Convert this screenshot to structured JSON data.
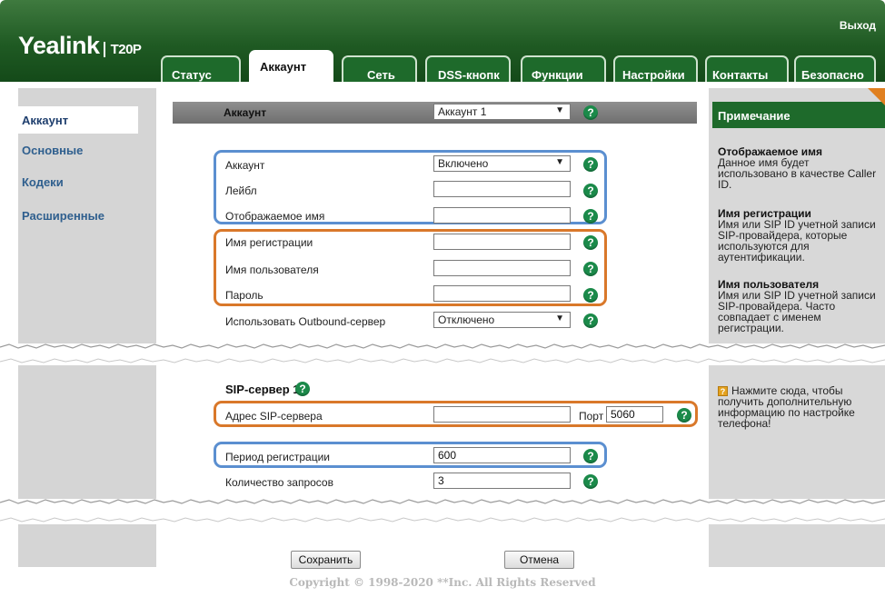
{
  "header": {
    "brand": "Yealink",
    "model": "T20P",
    "exit_label": "Выход",
    "tabs": [
      "Статус",
      "Аккаунт",
      "Сеть",
      "DSS-кнопк",
      "Функции",
      "Настройки",
      "Контакты",
      "Безопасно"
    ]
  },
  "sidebar": {
    "items": [
      "Аккаунт",
      "Основные",
      "Кодеки",
      "Расширенные"
    ]
  },
  "main": {
    "title": "Аккаунт",
    "account_select": "Аккаунт 1",
    "fields": {
      "account": {
        "label": "Аккаунт",
        "value": "Включено"
      },
      "label": {
        "label": "Лейбл",
        "value": ""
      },
      "display_name": {
        "label": "Отображаемое имя",
        "value": ""
      },
      "register_name": {
        "label": "Имя регистрации",
        "value": ""
      },
      "user_name": {
        "label": "Имя пользователя",
        "value": ""
      },
      "password": {
        "label": "Пароль",
        "value": ""
      },
      "outbound": {
        "label": "Использовать Outbound-сервер",
        "value": "Отключено"
      }
    },
    "sip_server": {
      "title": "SIP-сервер 1",
      "address_label": "Адрес SIP-сервера",
      "address_value": "",
      "port_label": "Порт",
      "port_value": "5060",
      "period_label": "Период регистрации",
      "period_value": "600",
      "retries_label": "Количество запросов",
      "retries_value": "3"
    },
    "buttons": {
      "save": "Сохранить",
      "cancel": "Отмена"
    },
    "help_glyph": "?"
  },
  "note": {
    "title": "Примечание",
    "entries": [
      {
        "title": "Отображаемое имя",
        "lines": [
          "Данное имя будет",
          "использовано в качестве Caller",
          "ID."
        ]
      },
      {
        "title": "Имя регистрации",
        "lines": [
          "Имя или SIP ID учетной записи",
          "SIP-провайдера, которые",
          "используются для",
          "аутентификации."
        ]
      },
      {
        "title": "Имя пользователя",
        "lines": [
          "Имя или SIP ID учетной записи",
          "SIP-провайдера. Часто",
          "совпадает с именем",
          "регистрации."
        ]
      }
    ],
    "more_info": [
      "Нажмите сюда, чтобы",
      "получить дополнительную",
      "информацию по настройке",
      "телефона!"
    ]
  },
  "footer": {
    "copyright": "Copyright © 1998-2020 **Inc. All Rights Reserved"
  },
  "colors": {
    "header_green": "#1e6a2b",
    "nav_link": "#2f5f8e",
    "highlight_blue": "#5b8fd0",
    "highlight_orange": "#d9782a",
    "help_green": "#1b8a4a"
  }
}
